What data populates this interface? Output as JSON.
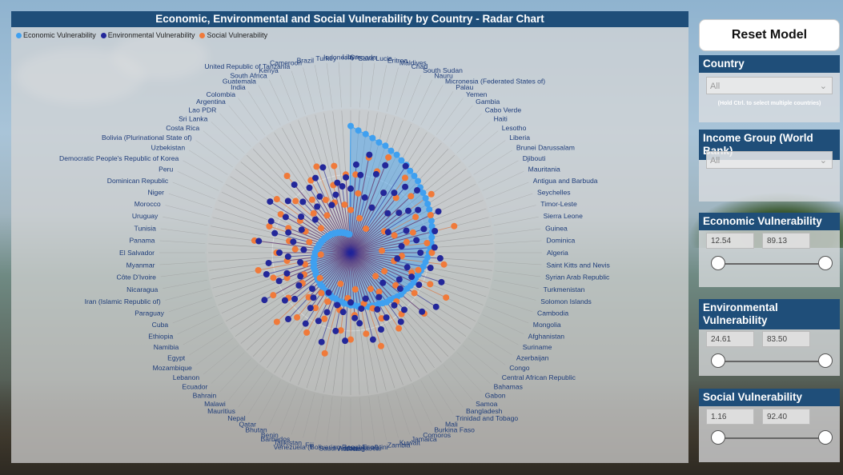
{
  "chart": {
    "title": "Economic, Environmental and Social Vulnerability by Country - Radar Chart",
    "legend": [
      {
        "label": "Economic Vulnerability",
        "color": "#3fa0f0"
      },
      {
        "label": "Environmental Vulnerability",
        "color": "#23279a"
      },
      {
        "label": "Social Vulnerability",
        "color": "#f07a3a"
      }
    ]
  },
  "chart_data": {
    "type": "radar",
    "categories": [
      "Libya",
      "Grenada",
      "Saint Lucia",
      "Eritrea",
      "Maldives",
      "Chad",
      "South Sudan",
      "Nauru",
      "Micronesia (Federated States of)",
      "Palau",
      "Yemen",
      "Gambia",
      "Cabo Verde",
      "Haiti",
      "Lesotho",
      "Liberia",
      "Brunei Darussalam",
      "Djibouti",
      "Mauritania",
      "Antigua and Barbuda",
      "Seychelles",
      "Timor-Leste",
      "Sierra Leone",
      "Guinea",
      "Dominica",
      "Algeria",
      "Saint Kitts and Nevis",
      "Syrian Arab Republic",
      "Turkmenistan",
      "Solomon Islands",
      "Cambodia",
      "Mongolia",
      "Afghanistan",
      "Suriname",
      "Azerbaijan",
      "Congo",
      "Central African Republic",
      "Bahamas",
      "Gabon",
      "Samoa",
      "Bangladesh",
      "Trinidad and Tobago",
      "Mali",
      "Burkina Faso",
      "Comoros",
      "Jamaica",
      "Kuwait",
      "Zambia",
      "Eswatini",
      "Madagascar",
      "Viet Nam",
      "Saudi Arabia",
      "Venezuela (Bolivarian Republic of)",
      "Fiji",
      "Tajikistan",
      "Barbados",
      "Benin",
      "Bhutan",
      "Qatar",
      "Nepal",
      "Mauritius",
      "Malawi",
      "Bahrain",
      "Ecuador",
      "Lebanon",
      "Mozambique",
      "Egypt",
      "Namibia",
      "Ethiopia",
      "Cuba",
      "Paraguay",
      "Iran (Islamic Republic of)",
      "Nicaragua",
      "Côte D'Ivoire",
      "Myanmar",
      "El Salvador",
      "Panama",
      "Tunisia",
      "Uruguay",
      "Morocco",
      "Niger",
      "Dominican Republic",
      "Peru",
      "Democratic People's Republic of Korea",
      "Uzbekistan",
      "Bolivia (Plurinational State of)",
      "Costa Rica",
      "Sri Lanka",
      "Lao PDR",
      "Argentina",
      "Colombia",
      "India",
      "Guatemala",
      "South Africa",
      "Kenya",
      "United Republic of Tanzania",
      "Cameroon",
      "Brazil",
      "Turkey",
      "Indonesia"
    ],
    "economic": [
      89,
      86,
      84,
      82,
      80,
      79,
      77,
      76,
      74,
      73,
      71,
      70,
      69,
      67,
      66,
      65,
      64,
      63,
      62,
      61,
      60,
      59,
      58,
      57,
      56,
      55,
      54,
      53,
      52,
      51,
      50,
      49,
      49,
      48,
      47,
      46,
      46,
      45,
      44,
      43,
      43,
      42,
      41,
      41,
      40,
      40,
      39,
      38,
      38,
      37,
      37,
      36,
      36,
      35,
      35,
      34,
      34,
      33,
      33,
      32,
      32,
      31,
      31,
      30,
      30,
      29,
      29,
      28,
      28,
      28,
      27,
      27,
      26,
      26,
      25,
      25,
      24,
      24,
      23,
      23,
      22,
      22,
      21,
      21,
      20,
      20,
      19,
      19,
      18,
      18,
      17,
      17,
      16,
      16,
      15,
      15,
      14,
      14,
      13,
      13
    ],
    "environmental": [
      45,
      62,
      55,
      70,
      40,
      58,
      66,
      35,
      48,
      72,
      52,
      60,
      38,
      64,
      44,
      50,
      56,
      30,
      68,
      42,
      54,
      61,
      47,
      36,
      59,
      49,
      63,
      33,
      57,
      41,
      67,
      46,
      53,
      39,
      71,
      43,
      65,
      31,
      55,
      48,
      60,
      37,
      52,
      44,
      58,
      34,
      63,
      40,
      50,
      46,
      35,
      62,
      42,
      56,
      38,
      66,
      45,
      53,
      32,
      59,
      48,
      41,
      64,
      37,
      51,
      57,
      43,
      69,
      39,
      54,
      47,
      61,
      36,
      58,
      44,
      50,
      33,
      65,
      41,
      55,
      46,
      60,
      38,
      52,
      67,
      43,
      57,
      34,
      49,
      62,
      40,
      54,
      45,
      58,
      36,
      63,
      42,
      50,
      47,
      53
    ],
    "social": [
      30,
      55,
      42,
      68,
      25,
      60,
      72,
      35,
      48,
      20,
      65,
      50,
      38,
      58,
      44,
      70,
      28,
      52,
      62,
      33,
      46,
      75,
      40,
      54,
      22,
      57,
      36,
      66,
      31,
      49,
      45,
      60,
      74,
      27,
      53,
      39,
      67,
      24,
      47,
      56,
      34,
      63,
      29,
      51,
      42,
      69,
      37,
      58,
      26,
      44,
      61,
      32,
      55,
      41,
      73,
      23,
      50,
      38,
      64,
      46,
      35,
      59,
      43,
      71,
      28,
      54,
      40,
      62,
      36,
      48,
      57,
      33,
      66,
      45,
      21,
      52,
      39,
      68,
      44,
      30,
      60,
      47,
      35,
      56,
      42,
      64,
      27,
      53,
      38,
      70,
      46,
      31,
      58,
      41,
      65,
      37,
      49,
      62,
      34,
      55
    ]
  },
  "sidebar": {
    "reset_label": "Reset Model",
    "country": {
      "header": "Country",
      "value": "All",
      "hint": "(Hold Ctrl. to select multiple countries)"
    },
    "income": {
      "header": "Income Group (World Bank)",
      "value": "All"
    },
    "economic": {
      "header": "Economic Vulnerability",
      "min": "12.54",
      "max": "89.13"
    },
    "environmental": {
      "header": "Environmental Vulnerability",
      "min": "24.61",
      "max": "83.50"
    },
    "social": {
      "header": "Social Vulnerability",
      "min": "1.16",
      "max": "92.40"
    }
  }
}
